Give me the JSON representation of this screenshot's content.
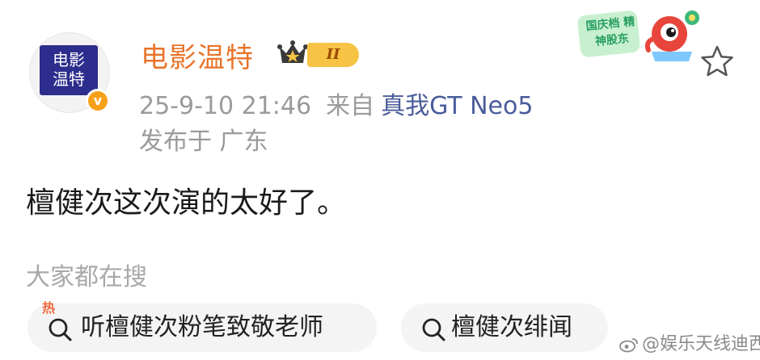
{
  "promo": {
    "text": "国庆档 精神股东"
  },
  "user": {
    "name": "电影温特",
    "avatar_text_line1": "电影",
    "avatar_text_line2": "温特",
    "verified_icon": "v-badge-icon",
    "rank_badge": "II"
  },
  "post": {
    "datetime": "25-9-10 21:46",
    "from_label": "来自",
    "device": "真我GT Neo5",
    "location": "发布于 广东",
    "text": "檀健次这次演的太好了。"
  },
  "search": {
    "title": "大家都在搜",
    "chips": [
      {
        "label": "听檀健次粉笔致敬老师",
        "icon": "hot-search-icon",
        "badge": "热"
      },
      {
        "label": "檀健次绯闻",
        "icon": "search-icon"
      }
    ]
  },
  "watermark": {
    "text": "@娱乐天线迪西"
  },
  "colors": {
    "username": "#e8742a",
    "device_link": "#4a5c9a",
    "meta": "#9a9a9a",
    "chip_bg": "#f4f4f4",
    "badge_gold": "#f6c344"
  }
}
